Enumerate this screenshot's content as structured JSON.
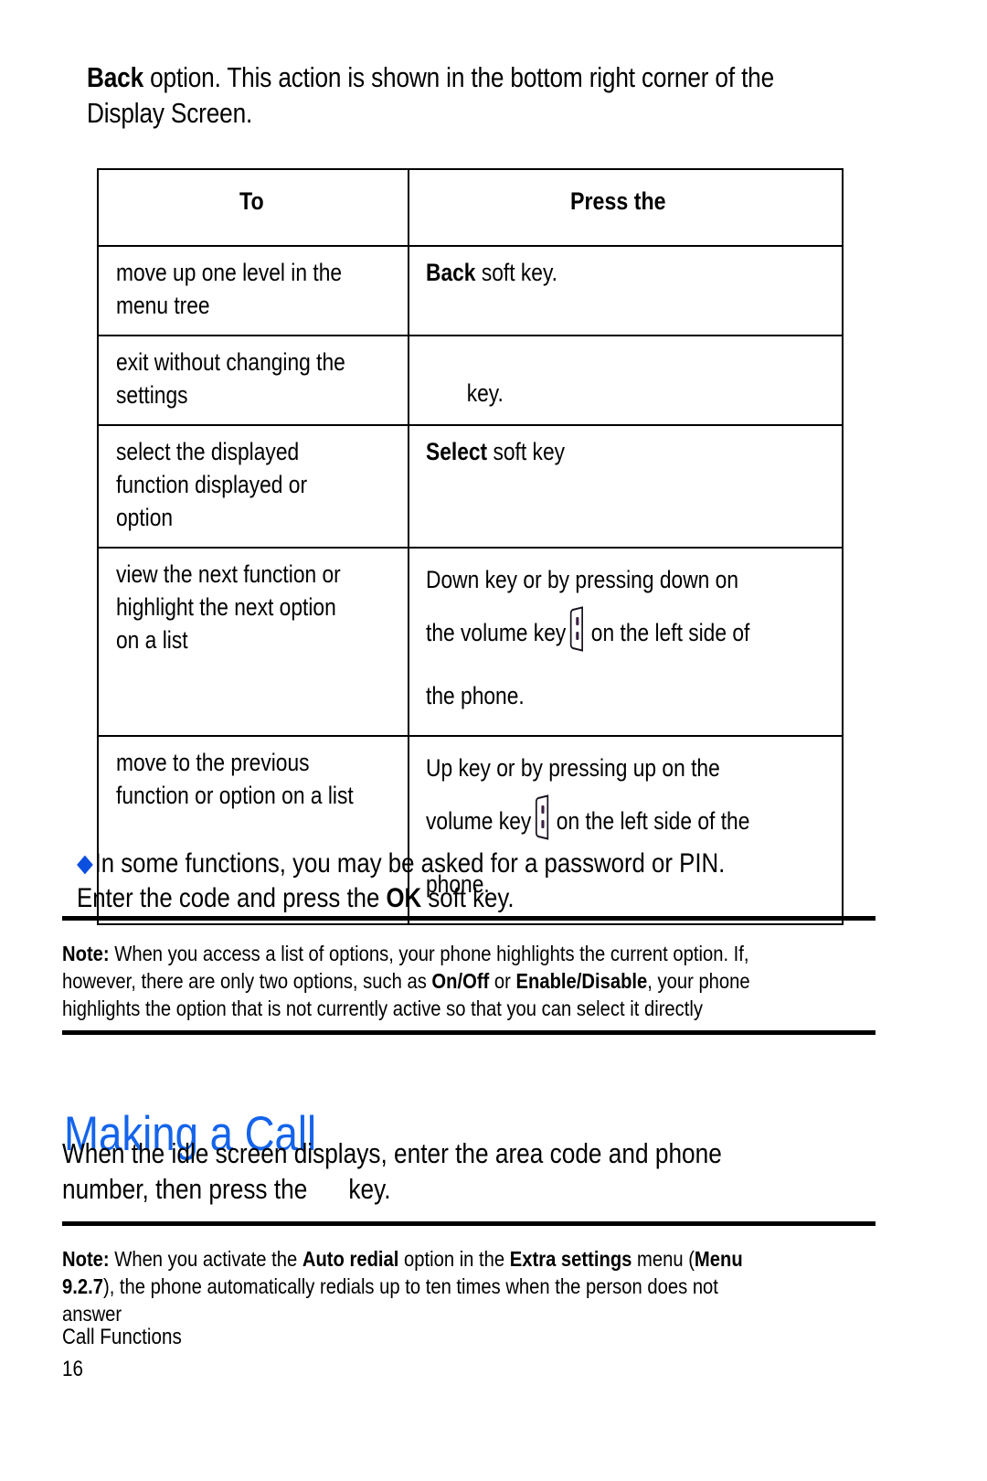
{
  "intro": {
    "bold_lead": "Back",
    "rest": " option. This action is shown in the bottom right corner of the Display Screen."
  },
  "table": {
    "headers": [
      "To",
      "Press the"
    ],
    "rows": [
      {
        "to": "move up one level in the menu tree",
        "press_bold": "Back",
        "press_rest": " soft key.",
        "icon": "none"
      },
      {
        "to": "exit without changing the settings",
        "press_bold": "",
        "press_rest": "key.",
        "icon": "missing-glyph"
      },
      {
        "to": "select the displayed function displayed or option",
        "press_bold": "Select",
        "press_rest": " soft key",
        "icon": "none"
      },
      {
        "to": "view the next function or highlight the next option on a list",
        "press_bold": "",
        "press_rest": "Down key or by pressing down on the volume key  on the left side of the phone.",
        "press_part1": "Down key or by pressing down on the volume key",
        "press_part2": "on the left side of the phone.",
        "icon": "volume-key-icon"
      },
      {
        "to": "move to the previous function or option on a list",
        "press_bold": "",
        "press_rest": "Up key or by pressing up on the volume key  on the left side of the phone.",
        "press_part1": "Up key or by pressing up on the volume key",
        "press_part2": "on the left side of the phone.",
        "icon": "volume-key-icon"
      }
    ]
  },
  "bullet_para": {
    "bullet_glyph": "◆",
    "part1": "In some functions, you may be asked for a password or PIN. Enter the code and press the ",
    "bold": "OK",
    "part2": " soft key."
  },
  "note1": {
    "label": "Note:",
    "part1": " When you access a list of options, your phone highlights the current option. If, however, there are only two options, such as ",
    "bold1": "On/Off",
    "part2": " or ",
    "bold2": "Enable/Disable",
    "part3": ", your phone highlights the option that is not currently active so that you can select it directly"
  },
  "heading": {
    "title": "Making a Call"
  },
  "body_para": {
    "part1": "When the idle screen displays, enter the area code and phone number, then press the ",
    "part2": "key."
  },
  "note2": {
    "label": "Note:",
    "part1": " When you activate the ",
    "bold1": "Auto redial",
    "part2": " option in the ",
    "bold2": "Extra settings",
    "part3": " menu (",
    "bold3": "Menu 9.2.7",
    "part4": "), the phone automatically redials up to ten times when the person does not answer"
  },
  "footer": {
    "section": "Call Functions",
    "page": "16"
  },
  "colors": {
    "bullet_blue": "#0b4fe0",
    "heading_blue": "#1464eb",
    "text_black": "#000000",
    "page_background": "#ffffff"
  }
}
